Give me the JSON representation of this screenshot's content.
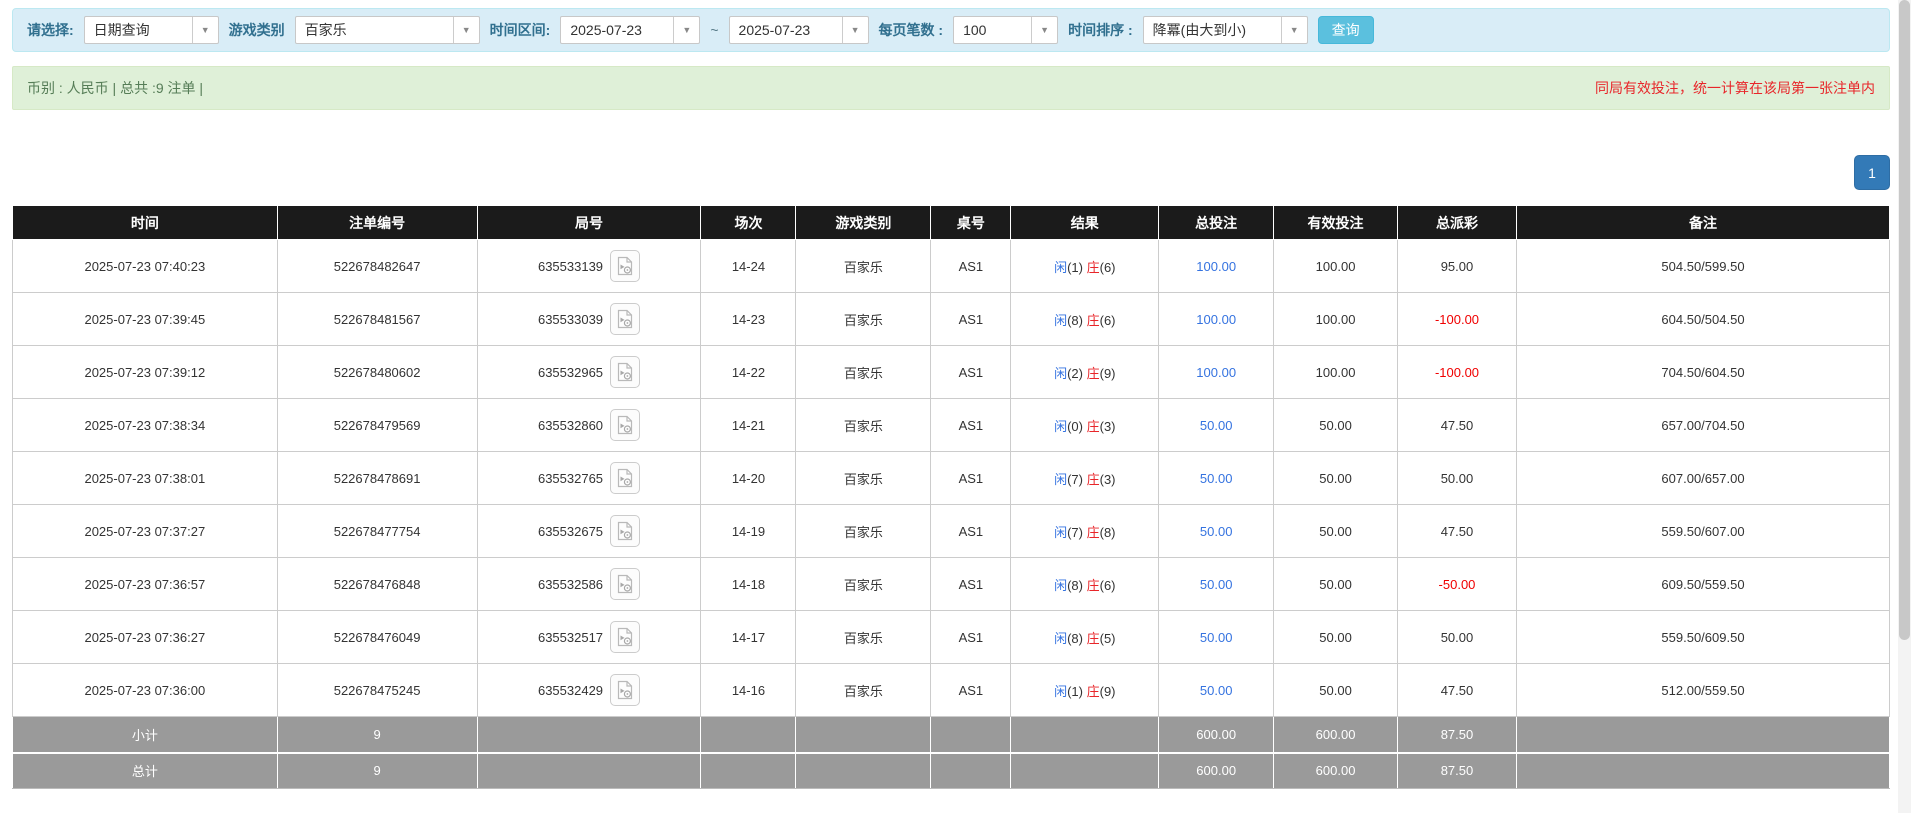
{
  "colors": {
    "header-bg": "#1b1b1b",
    "filter-bg": "#d9edf7",
    "filter-border": "#bce8f1",
    "label-blue": "#31708f",
    "success-bg": "#dff0d8",
    "success-border": "#d6e9c6",
    "success-text": "#567d57",
    "alert-red": "#e8262a",
    "link-blue": "#3573e0",
    "banker-red": "#e8262a",
    "neg-red": "#f00000",
    "summary-bg": "#9a9a9a",
    "btn-search": "#5bc0de",
    "page-active": "#337ab7"
  },
  "filters": {
    "select_label": "请选择:",
    "select_value": "日期查询",
    "game_label": "游戏类别",
    "game_value": "百家乐",
    "range_label": "时间区间:",
    "date_from": "2025-07-23",
    "tilde": "~",
    "date_to": "2025-07-23",
    "per_page_label": "每页笔数 :",
    "per_page_value": "100",
    "sort_label": "时间排序 :",
    "sort_value": "降冪(由大到小)",
    "search_button": "查询"
  },
  "summary_bar": {
    "left": "币别 : 人民币 | 总共 :9 注单 |",
    "right": "同局有效投注，统一计算在该局第一张注单内"
  },
  "pagination": {
    "page": "1"
  },
  "table": {
    "headers": [
      "时间",
      "注单编号",
      "局号",
      "场次",
      "游戏类别",
      "桌号",
      "结果",
      "总投注",
      "有效投注",
      "总派彩",
      "备注"
    ],
    "rows": [
      {
        "time": "2025-07-23 07:40:23",
        "bet_id": "522678482647",
        "round_id": "635533139",
        "session": "14-24",
        "game": "百家乐",
        "table_no": "AS1",
        "player": "闲",
        "pnum": "(1)",
        "banker": "庄",
        "bnum": "(6)",
        "total_bet": "100.00",
        "valid_bet": "100.00",
        "payout": "95.00",
        "remark": "504.50/599.50"
      },
      {
        "time": "2025-07-23 07:39:45",
        "bet_id": "522678481567",
        "round_id": "635533039",
        "session": "14-23",
        "game": "百家乐",
        "table_no": "AS1",
        "player": "闲",
        "pnum": "(8)",
        "banker": "庄",
        "bnum": "(6)",
        "total_bet": "100.00",
        "valid_bet": "100.00",
        "payout": "-100.00",
        "remark": "604.50/504.50"
      },
      {
        "time": "2025-07-23 07:39:12",
        "bet_id": "522678480602",
        "round_id": "635532965",
        "session": "14-22",
        "game": "百家乐",
        "table_no": "AS1",
        "player": "闲",
        "pnum": "(2)",
        "banker": "庄",
        "bnum": "(9)",
        "total_bet": "100.00",
        "valid_bet": "100.00",
        "payout": "-100.00",
        "remark": "704.50/604.50"
      },
      {
        "time": "2025-07-23 07:38:34",
        "bet_id": "522678479569",
        "round_id": "635532860",
        "session": "14-21",
        "game": "百家乐",
        "table_no": "AS1",
        "player": "闲",
        "pnum": "(0)",
        "banker": "庄",
        "bnum": "(3)",
        "total_bet": "50.00",
        "valid_bet": "50.00",
        "payout": "47.50",
        "remark": "657.00/704.50"
      },
      {
        "time": "2025-07-23 07:38:01",
        "bet_id": "522678478691",
        "round_id": "635532765",
        "session": "14-20",
        "game": "百家乐",
        "table_no": "AS1",
        "player": "闲",
        "pnum": "(7)",
        "banker": "庄",
        "bnum": "(3)",
        "total_bet": "50.00",
        "valid_bet": "50.00",
        "payout": "50.00",
        "remark": "607.00/657.00"
      },
      {
        "time": "2025-07-23 07:37:27",
        "bet_id": "522678477754",
        "round_id": "635532675",
        "session": "14-19",
        "game": "百家乐",
        "table_no": "AS1",
        "player": "闲",
        "pnum": "(7)",
        "banker": "庄",
        "bnum": "(8)",
        "total_bet": "50.00",
        "valid_bet": "50.00",
        "payout": "47.50",
        "remark": "559.50/607.00"
      },
      {
        "time": "2025-07-23 07:36:57",
        "bet_id": "522678476848",
        "round_id": "635532586",
        "session": "14-18",
        "game": "百家乐",
        "table_no": "AS1",
        "player": "闲",
        "pnum": "(8)",
        "banker": "庄",
        "bnum": "(6)",
        "total_bet": "50.00",
        "valid_bet": "50.00",
        "payout": "-50.00",
        "remark": "609.50/559.50"
      },
      {
        "time": "2025-07-23 07:36:27",
        "bet_id": "522678476049",
        "round_id": "635532517",
        "session": "14-17",
        "game": "百家乐",
        "table_no": "AS1",
        "player": "闲",
        "pnum": "(8)",
        "banker": "庄",
        "bnum": "(5)",
        "total_bet": "50.00",
        "valid_bet": "50.00",
        "payout": "50.00",
        "remark": "559.50/609.50"
      },
      {
        "time": "2025-07-23 07:36:00",
        "bet_id": "522678475245",
        "round_id": "635532429",
        "session": "14-16",
        "game": "百家乐",
        "table_no": "AS1",
        "player": "闲",
        "pnum": "(1)",
        "banker": "庄",
        "bnum": "(9)",
        "total_bet": "50.00",
        "valid_bet": "50.00",
        "payout": "47.50",
        "remark": "512.00/559.50"
      }
    ],
    "subtotal": {
      "label": "小计",
      "count": "9",
      "total_bet": "600.00",
      "valid_bet": "600.00",
      "payout": "87.50"
    },
    "total": {
      "label": "总计",
      "count": "9",
      "total_bet": "600.00",
      "valid_bet": "600.00",
      "payout": "87.50"
    }
  }
}
